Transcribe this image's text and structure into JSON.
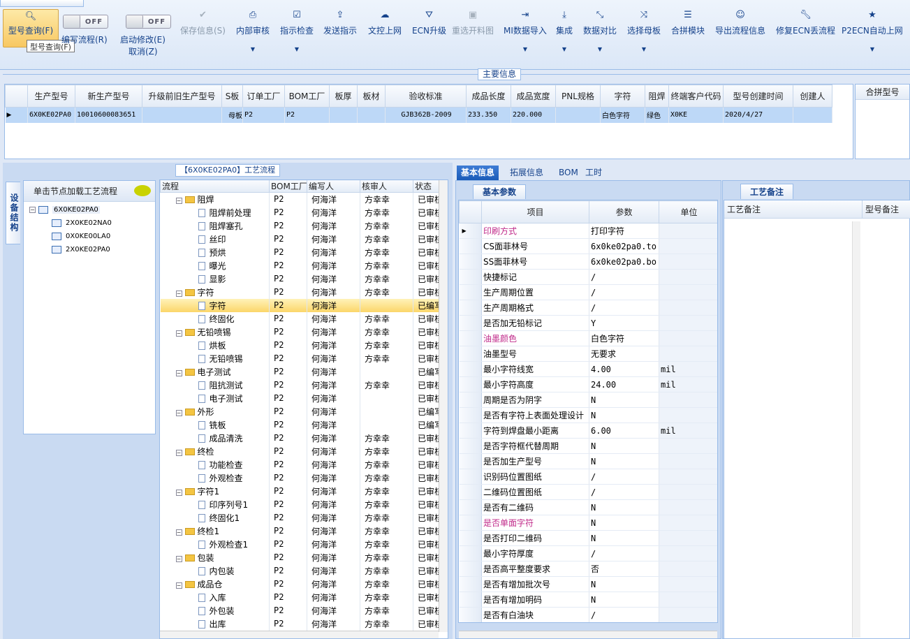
{
  "toolbar": {
    "top_tab": "",
    "model_query": "型号查询(F)",
    "tooltip": "型号查询(F)",
    "edit_flow": "编写流程(R)",
    "edit_flow_toggle": "OFF",
    "start_modify": "启动修改(E)",
    "start_modify_toggle": "OFF",
    "cancel": "取消(Z)",
    "save_info": "保存信息(S)",
    "internal_review": "内部审核",
    "instruction_check": "指示检查",
    "send_instruction": "发送指示",
    "upload_doc": "文控上网",
    "ecn_upgrade": "ECN升级",
    "reselect_material": "重选开料图",
    "mi_import": "MI数据导入",
    "integrate": "集成",
    "data_compare": "数据对比",
    "select_mother": "选择母板",
    "merge_module": "合拼模块",
    "export_flow": "导出流程信息",
    "fix_ecn": "修复ECN丢流程",
    "p2_ecn_auto": "P2ECN自动上网"
  },
  "main_info": {
    "title": "主要信息",
    "columns": [
      "生产型号",
      "新生产型号",
      "升级前旧生产型号",
      "S板",
      "订单工厂",
      "BOM工厂",
      "板厚",
      "板材",
      "验收标准",
      "成品长度",
      "成品宽度",
      "PNL规格",
      "字符",
      "阻焊",
      "终端客户代码",
      "型号创建时间",
      "创建人"
    ],
    "row": [
      "6X0KE02PA0",
      "10010600083651",
      "",
      "母板",
      "P2",
      "P2",
      "",
      "",
      "GJB362B-2009",
      "233.350",
      "220.000",
      "",
      "白色字符",
      "绿色",
      "X0KE",
      "2020/4/27",
      ""
    ],
    "merge_header": "合拼型号"
  },
  "left": {
    "side_tab": "设备结构",
    "tree_header": "单击节点加载工艺流程",
    "tree_root": "6X0KE02PA0",
    "tree_children": [
      "2X0KE02NA0",
      "0X0KE00LA0",
      "2X0KE02PA0"
    ]
  },
  "flow": {
    "title": "【6X0KE02PA0】工艺流程",
    "columns": [
      "流程",
      "BOM工厂",
      "编写人",
      "核审人",
      "状态"
    ],
    "rows": [
      {
        "name": "阻焊",
        "level": 0,
        "bom": "P2",
        "writer": "何海洋",
        "reviewer": "方幸幸",
        "status": "已审核"
      },
      {
        "name": "阻焊前处理",
        "level": 1,
        "bom": "P2",
        "writer": "何海洋",
        "reviewer": "方幸幸",
        "status": "已审核"
      },
      {
        "name": "阻焊塞孔",
        "level": 1,
        "bom": "P2",
        "writer": "何海洋",
        "reviewer": "方幸幸",
        "status": "已审核"
      },
      {
        "name": "丝印",
        "level": 1,
        "bom": "P2",
        "writer": "何海洋",
        "reviewer": "方幸幸",
        "status": "已审核"
      },
      {
        "name": "预烘",
        "level": 1,
        "bom": "P2",
        "writer": "何海洋",
        "reviewer": "方幸幸",
        "status": "已审核"
      },
      {
        "name": "曝光",
        "level": 1,
        "bom": "P2",
        "writer": "何海洋",
        "reviewer": "方幸幸",
        "status": "已审核"
      },
      {
        "name": "显影",
        "level": 1,
        "bom": "P2",
        "writer": "何海洋",
        "reviewer": "方幸幸",
        "status": "已审核"
      },
      {
        "name": "字符",
        "level": 0,
        "bom": "P2",
        "writer": "何海洋",
        "reviewer": "方幸幸",
        "status": "已审核"
      },
      {
        "name": "字符",
        "level": 1,
        "bom": "P2",
        "writer": "何海洋",
        "reviewer": "",
        "status": "已编写",
        "selected": true
      },
      {
        "name": "终固化",
        "level": 1,
        "bom": "P2",
        "writer": "何海洋",
        "reviewer": "方幸幸",
        "status": "已审核"
      },
      {
        "name": "无铅喷锡",
        "level": 0,
        "bom": "P2",
        "writer": "何海洋",
        "reviewer": "方幸幸",
        "status": "已审核"
      },
      {
        "name": "烘板",
        "level": 1,
        "bom": "P2",
        "writer": "何海洋",
        "reviewer": "方幸幸",
        "status": "已审核"
      },
      {
        "name": "无铅喷锡",
        "level": 1,
        "bom": "P2",
        "writer": "何海洋",
        "reviewer": "方幸幸",
        "status": "已审核"
      },
      {
        "name": "电子测试",
        "level": 0,
        "bom": "P2",
        "writer": "何海洋",
        "reviewer": "",
        "status": "已编写"
      },
      {
        "name": "阻抗测试",
        "level": 1,
        "bom": "P2",
        "writer": "何海洋",
        "reviewer": "方幸幸",
        "status": "已审核"
      },
      {
        "name": "电子测试",
        "level": 1,
        "bom": "P2",
        "writer": "何海洋",
        "reviewer": "",
        "status": "已审核"
      },
      {
        "name": "外形",
        "level": 0,
        "bom": "P2",
        "writer": "何海洋",
        "reviewer": "",
        "status": "已编写"
      },
      {
        "name": "铣板",
        "level": 1,
        "bom": "P2",
        "writer": "何海洋",
        "reviewer": "",
        "status": "已编写"
      },
      {
        "name": "成品清洗",
        "level": 1,
        "bom": "P2",
        "writer": "何海洋",
        "reviewer": "方幸幸",
        "status": "已审核"
      },
      {
        "name": "终检",
        "level": 0,
        "bom": "P2",
        "writer": "何海洋",
        "reviewer": "方幸幸",
        "status": "已审核"
      },
      {
        "name": "功能检查",
        "level": 1,
        "bom": "P2",
        "writer": "何海洋",
        "reviewer": "方幸幸",
        "status": "已审核"
      },
      {
        "name": "外观检查",
        "level": 1,
        "bom": "P2",
        "writer": "何海洋",
        "reviewer": "方幸幸",
        "status": "已审核"
      },
      {
        "name": "字符1",
        "level": 0,
        "bom": "P2",
        "writer": "何海洋",
        "reviewer": "方幸幸",
        "status": "已审核"
      },
      {
        "name": "印序列号1",
        "level": 1,
        "bom": "P2",
        "writer": "何海洋",
        "reviewer": "方幸幸",
        "status": "已审核"
      },
      {
        "name": "终固化1",
        "level": 1,
        "bom": "P2",
        "writer": "何海洋",
        "reviewer": "方幸幸",
        "status": "已审核"
      },
      {
        "name": "终检1",
        "level": 0,
        "bom": "P2",
        "writer": "何海洋",
        "reviewer": "方幸幸",
        "status": "已审核"
      },
      {
        "name": "外观检查1",
        "level": 1,
        "bom": "P2",
        "writer": "何海洋",
        "reviewer": "方幸幸",
        "status": "已审核"
      },
      {
        "name": "包装",
        "level": 0,
        "bom": "P2",
        "writer": "何海洋",
        "reviewer": "方幸幸",
        "status": "已审核"
      },
      {
        "name": "内包装",
        "level": 1,
        "bom": "P2",
        "writer": "何海洋",
        "reviewer": "方幸幸",
        "status": "已审核"
      },
      {
        "name": "成品仓",
        "level": 0,
        "bom": "P2",
        "writer": "何海洋",
        "reviewer": "方幸幸",
        "status": "已审核"
      },
      {
        "name": "入库",
        "level": 1,
        "bom": "P2",
        "writer": "何海洋",
        "reviewer": "方幸幸",
        "status": "已审核"
      },
      {
        "name": "外包装",
        "level": 1,
        "bom": "P2",
        "writer": "何海洋",
        "reviewer": "方幸幸",
        "status": "已审核"
      },
      {
        "name": "出库",
        "level": 1,
        "bom": "P2",
        "writer": "何海洋",
        "reviewer": "方幸幸",
        "status": "已审核"
      }
    ]
  },
  "right": {
    "tabs": [
      "基本信息",
      "拓展信息",
      "BOM",
      "工时"
    ],
    "basic_title": "基本参数",
    "param_columns": [
      "项目",
      "参数",
      "单位"
    ],
    "params": [
      {
        "item": "印刷方式",
        "value": "打印字符",
        "unit": "",
        "pink": true
      },
      {
        "item": "CS面菲林号",
        "value": "6x0ke02pa0.to",
        "unit": ""
      },
      {
        "item": "SS面菲林号",
        "value": "6x0ke02pa0.bo",
        "unit": ""
      },
      {
        "item": "快捷标记",
        "value": "/",
        "unit": ""
      },
      {
        "item": "生产周期位置",
        "value": "/",
        "unit": ""
      },
      {
        "item": "生产周期格式",
        "value": "/",
        "unit": ""
      },
      {
        "item": "是否加无铅标记",
        "value": "Y",
        "unit": ""
      },
      {
        "item": "油墨颜色",
        "value": "白色字符",
        "unit": "",
        "pink": true
      },
      {
        "item": "油墨型号",
        "value": "无要求",
        "unit": ""
      },
      {
        "item": "最小字符线宽",
        "value": "4.00",
        "unit": "mil"
      },
      {
        "item": "最小字符高度",
        "value": "24.00",
        "unit": "mil"
      },
      {
        "item": "周期是否为阴字",
        "value": "N",
        "unit": ""
      },
      {
        "item": "是否有字符上表面处理设计",
        "value": "N",
        "unit": ""
      },
      {
        "item": "字符到焊盘最小距离",
        "value": "6.00",
        "unit": "mil"
      },
      {
        "item": "是否字符框代替周期",
        "value": "N",
        "unit": ""
      },
      {
        "item": "是否加生产型号",
        "value": "N",
        "unit": ""
      },
      {
        "item": "识别码位置图纸",
        "value": "/",
        "unit": ""
      },
      {
        "item": "二维码位置图纸",
        "value": "/",
        "unit": ""
      },
      {
        "item": "是否有二维码",
        "value": "N",
        "unit": ""
      },
      {
        "item": "是否单面字符",
        "value": "N",
        "unit": "",
        "pink": true
      },
      {
        "item": "是否打印二维码",
        "value": "N",
        "unit": ""
      },
      {
        "item": "最小字符厚度",
        "value": "/",
        "unit": ""
      },
      {
        "item": "是否高平整度要求",
        "value": "否",
        "unit": ""
      },
      {
        "item": "是否有增加批次号",
        "value": "N",
        "unit": ""
      },
      {
        "item": "是否有增加明码",
        "value": "N",
        "unit": ""
      },
      {
        "item": "是否有白油块",
        "value": "/",
        "unit": ""
      }
    ],
    "remark_title": "工艺备注",
    "remark_col1": "工艺备注",
    "remark_col2": "型号备注"
  }
}
